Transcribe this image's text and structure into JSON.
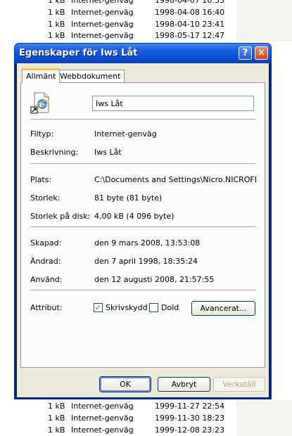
{
  "background_list": {
    "rows_top": [
      {
        "size": "1 kB",
        "type": "Internet-genväg",
        "date": "1998-04-07 10:33"
      },
      {
        "size": "1 kB",
        "type": "Internet-genväg",
        "date": "1998-04-08 16:40"
      },
      {
        "size": "1 kB",
        "type": "Internet-genväg",
        "date": "1998-04-10 23:41"
      },
      {
        "size": "1 kB",
        "type": "Internet-genväg",
        "date": "1998-05-17 12:47"
      }
    ],
    "rows_bottom": [
      {
        "size": "1 kB",
        "type": "Internet-genväg",
        "date": "1999-11-27 22:54"
      },
      {
        "size": "1 kB",
        "type": "Internet-genväg",
        "date": "1999-11-30 18:23"
      },
      {
        "size": "1 kB",
        "type": "Internet-genväg",
        "date": "1999-12-08 23:23"
      }
    ]
  },
  "dialog": {
    "title": "Egenskaper för Iws Låt",
    "help_glyph": "?",
    "close_glyph": "✕",
    "tabs": [
      {
        "label": "Allmänt",
        "active": true
      },
      {
        "label": "Webbdokument",
        "active": false
      }
    ],
    "file_icon": "internet-shortcut-icon",
    "name_value": "Iws Låt",
    "fields": {
      "filtyp": {
        "label": "Filtyp:",
        "value": "Internet-genväg"
      },
      "beskrivning": {
        "label": "Beskrivning:",
        "value": "Iws Låt"
      },
      "plats": {
        "label": "Plats:",
        "value": "C:\\Documents and Settings\\Nicro.NICROFIXIT\\"
      },
      "storlek": {
        "label": "Storlek:",
        "value": "81 byte (81 byte)"
      },
      "storlek_disk": {
        "label": "Storlek på disk:",
        "value": "4,00 kB (4 096 byte)"
      },
      "skapad": {
        "label": "Skapad:",
        "value": "den 9 mars 2008, 13:53:08"
      },
      "andrad": {
        "label": "Ändrad:",
        "value": "den 7 april 1998, 18:35:24"
      },
      "anvand": {
        "label": "Använd:",
        "value": "den 12 augusti 2008, 21:57:55"
      }
    },
    "attribut": {
      "label": "Attribut:",
      "skrivskydd": {
        "label": "Skrivskydd",
        "checked": true
      },
      "dold": {
        "label": "Dold",
        "checked": false
      },
      "advanced_label": "Avancerat..."
    },
    "buttons": {
      "ok": "OK",
      "cancel": "Avbryt",
      "apply": "Verkställ"
    },
    "colors": {
      "titlebar": "#0a4fd7",
      "face": "#ece9d8",
      "close": "#d2431b"
    }
  }
}
